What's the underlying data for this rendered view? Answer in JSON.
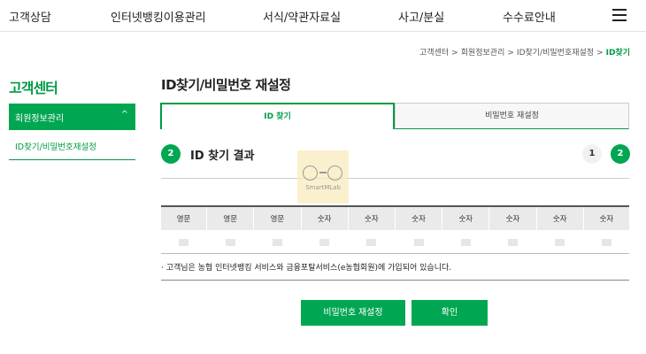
{
  "topnav": {
    "items": [
      "고객상담",
      "인터넷뱅킹이용관리",
      "서식/약관자료실",
      "사고/분실",
      "수수료안내"
    ]
  },
  "breadcrumb": [
    "고객센터",
    "회원정보관리",
    "ID찾기/비밀번호재설정",
    "ID찾기"
  ],
  "sidebar": {
    "title": "고객센터",
    "menu_label": "회원정보관리",
    "menu_chevron": "^",
    "sub_item": "ID찾기/비밀번호재설정"
  },
  "main": {
    "title": "ID찾기/비밀번호 재설정",
    "tabs": [
      {
        "label": "ID 찾기",
        "active": true
      },
      {
        "label": "비밀번호 재설정",
        "active": false
      }
    ],
    "section": {
      "step": "2",
      "title": "ID 찾기 결과"
    },
    "steps": [
      "1",
      "2"
    ],
    "watermark": "SmartMLab",
    "table": {
      "headers": [
        "영문",
        "영문",
        "영문",
        "숫자",
        "숫자",
        "숫자",
        "숫자",
        "숫자",
        "숫자",
        "숫자"
      ]
    },
    "notice": "· 고객님은 농협 인터넷뱅킹 서비스와 금융포탈서비스(e농협회원)에 가입되어 있습니다.",
    "buttons": {
      "reset_password": "비밀번호 재설정",
      "confirm": "확인"
    }
  },
  "colors": {
    "accent": "#00a651",
    "accent_dark": "#009a44"
  }
}
